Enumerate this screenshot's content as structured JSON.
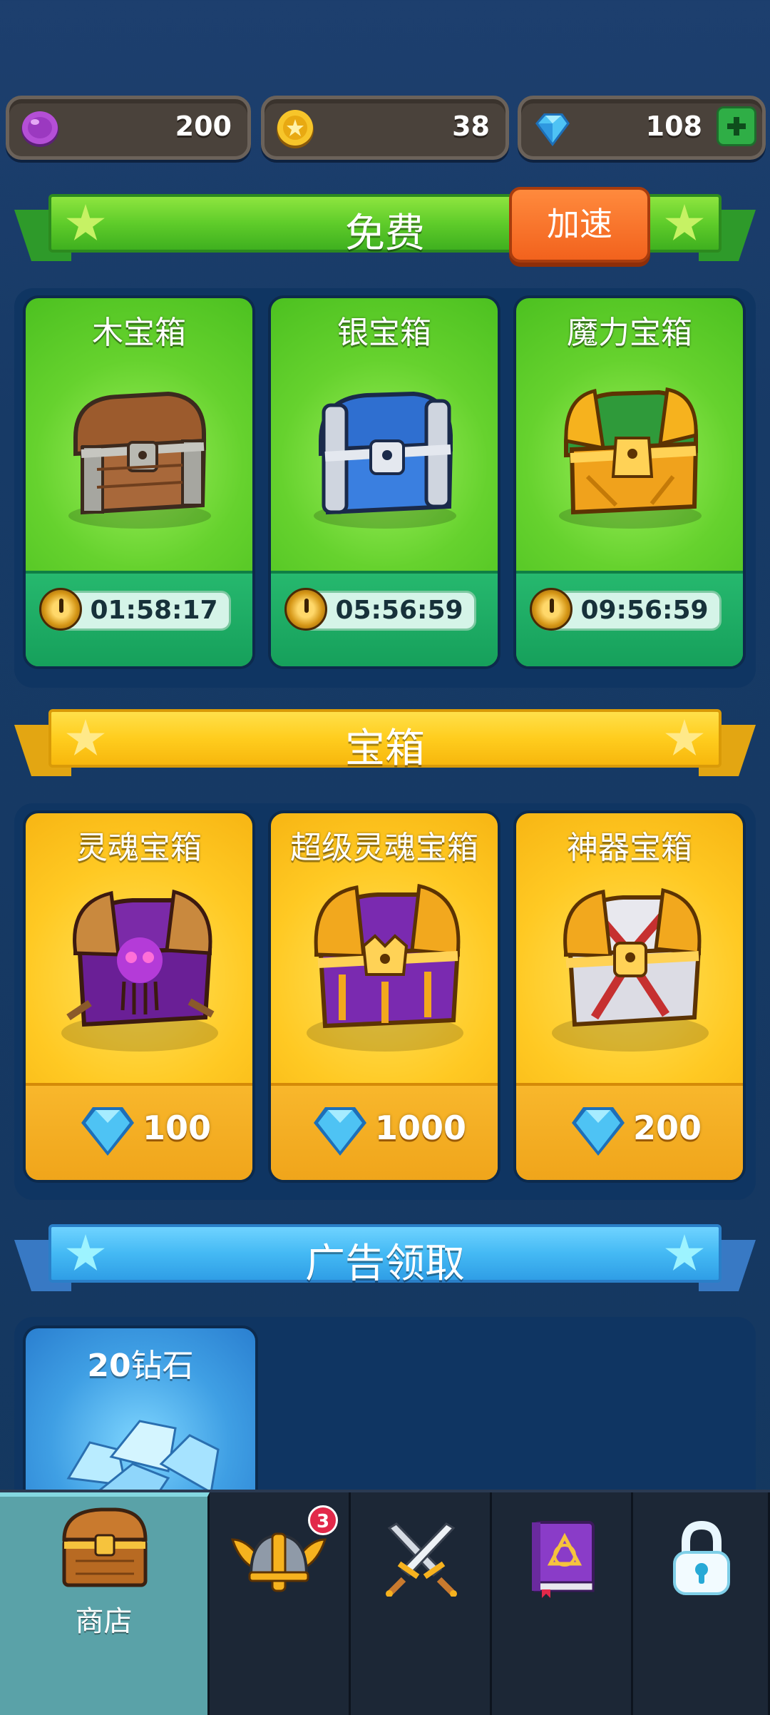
{
  "currencies": {
    "purple_coin": {
      "icon": "purple-coin-icon",
      "value": "200"
    },
    "gold_coin": {
      "icon": "gold-coin-icon",
      "value": "38"
    },
    "gem": {
      "icon": "blue-gem-icon",
      "value": "108"
    }
  },
  "sections": {
    "free": {
      "title": "免费",
      "speed_button": "加速"
    },
    "chests": {
      "title": "宝箱"
    },
    "ads": {
      "title": "广告领取"
    }
  },
  "free_chests": [
    {
      "name": "木宝箱",
      "timer": "01:58:17",
      "icon": "wooden-chest-icon"
    },
    {
      "name": "银宝箱",
      "timer": "05:56:59",
      "icon": "silver-chest-icon"
    },
    {
      "name": "魔力宝箱",
      "timer": "09:56:59",
      "icon": "magic-chest-icon"
    }
  ],
  "paid_chests": [
    {
      "name": "灵魂宝箱",
      "price": "100",
      "icon": "soul-chest-icon"
    },
    {
      "name": "超级灵魂宝箱",
      "price": "1000",
      "icon": "super-soul-chest-icon"
    },
    {
      "name": "神器宝箱",
      "price": "200",
      "icon": "artifact-chest-icon"
    }
  ],
  "ad_rewards": [
    {
      "prefix": "20",
      "suffix": "钻石",
      "icon": "diamond-pile-icon"
    }
  ],
  "nav": [
    {
      "label": "商店",
      "icon": "treasure-chest-icon",
      "active": true
    },
    {
      "label": "",
      "icon": "winged-helmet-icon",
      "badge": "3"
    },
    {
      "label": "",
      "icon": "crossed-swords-icon"
    },
    {
      "label": "",
      "icon": "spellbook-icon"
    },
    {
      "label": "",
      "icon": "padlock-icon"
    }
  ],
  "colors": {
    "background": "#173a66",
    "green_card": "#66d22e",
    "gold_card": "#ffc923",
    "accent_orange": "#f2621d"
  }
}
